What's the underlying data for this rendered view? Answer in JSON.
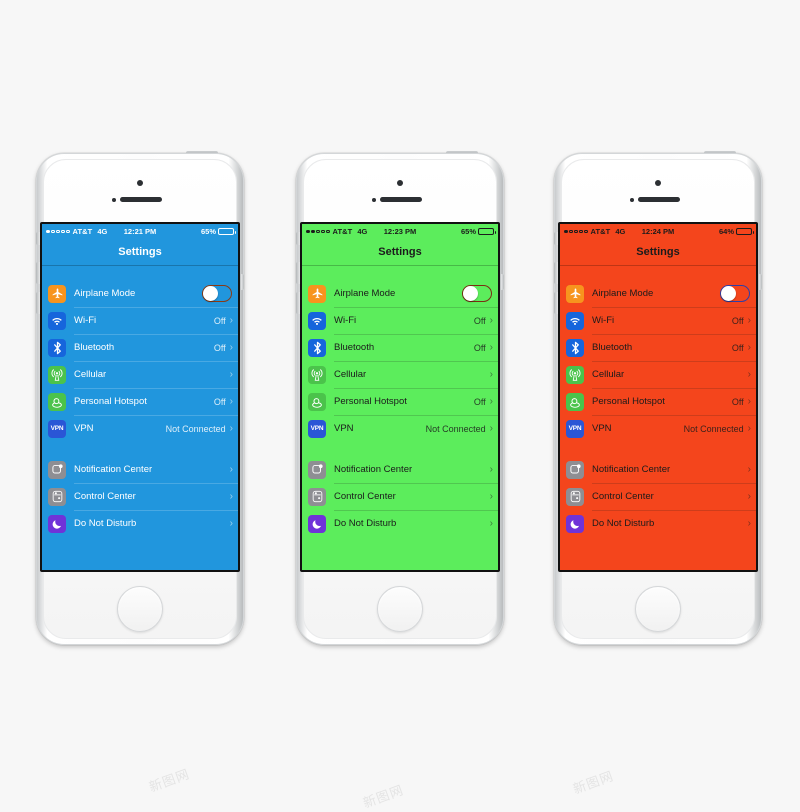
{
  "page": {
    "background": "#f7f7f7",
    "watermark_text": "新图网"
  },
  "icon_colors": {
    "airplane": "#f7941e",
    "wifi": "#1665dc",
    "bluetooth": "#1665dc",
    "cellular": "#4bc34b",
    "hotspot": "#4bc34b",
    "vpn": "#2a56d6",
    "notification_center": "#8e8e93",
    "control_center": "#8e8e93",
    "do_not_disturb": "#6f33d8"
  },
  "rows": {
    "labels": {
      "airplane_mode": "Airplane Mode",
      "wifi": "Wi-Fi",
      "bluetooth": "Bluetooth",
      "cellular": "Cellular",
      "personal_hotspot": "Personal Hotspot",
      "vpn": "VPN",
      "notification_center": "Notification Center",
      "control_center": "Control Center",
      "do_not_disturb": "Do Not Disturb"
    },
    "values": {
      "wifi": "Off",
      "bluetooth": "Off",
      "cellular": "",
      "personal_hotspot": "Off",
      "vpn": "Not Connected"
    },
    "chevron": "›"
  },
  "phones": [
    {
      "id": "phone-blue",
      "screen_bg": "#2196dd",
      "text_color": "#ffffff",
      "toggle_border": "#8a3a14",
      "nav_title": "Settings",
      "status": {
        "signal_dots_filled": 1,
        "signal_dots_total": 5,
        "carrier": "AT&T",
        "network": "4G",
        "time": "12:21 PM",
        "battery_percent": "65%",
        "battery_fill": 65
      }
    },
    {
      "id": "phone-green",
      "screen_bg": "#5ced5c",
      "text_color": "#1b1b1b",
      "toggle_border": "#7a2f12",
      "nav_title": "Settings",
      "status": {
        "signal_dots_filled": 2,
        "signal_dots_total": 5,
        "carrier": "AT&T",
        "network": "4G",
        "time": "12:23 PM",
        "battery_percent": "65%",
        "battery_fill": 65
      }
    },
    {
      "id": "phone-orange",
      "screen_bg": "#f4451c",
      "text_color": "#1b1b1b",
      "toggle_border": "#2f3fa8",
      "nav_title": "Settings",
      "status": {
        "signal_dots_filled": 1,
        "signal_dots_total": 5,
        "carrier": "AT&T",
        "network": "4G",
        "time": "12:24 PM",
        "battery_percent": "64%",
        "battery_fill": 64
      }
    }
  ]
}
